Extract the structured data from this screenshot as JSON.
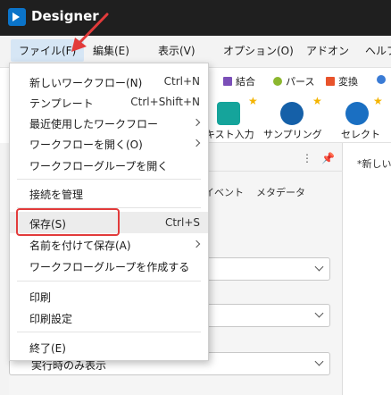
{
  "app": {
    "title": "Designer"
  },
  "menubar": {
    "items": [
      {
        "label": "ファイル(F)"
      },
      {
        "label": "編集(E)"
      },
      {
        "label": "表示(V)"
      },
      {
        "label": "オプション(O)"
      },
      {
        "label": "アドオン"
      },
      {
        "label": "ヘルプ"
      }
    ]
  },
  "toolbar": {
    "categories": [
      {
        "label": "結合",
        "color": "#7b4fb8"
      },
      {
        "label": "パース",
        "color": "#8cb72e"
      },
      {
        "label": "変換",
        "color": "#e8532b"
      }
    ],
    "tools": [
      {
        "label": "キスト入力",
        "color": "#15a49b"
      },
      {
        "label": "サンプリング",
        "color": "#1560a8"
      },
      {
        "label": "セレクト",
        "color": "#1a6fc2"
      }
    ]
  },
  "panel": {
    "tabs": [
      "イベント",
      "メタデータ"
    ],
    "select_value": "実行時のみ表示"
  },
  "canvas": {
    "tab_label": "*新しい"
  },
  "file_menu": {
    "items": [
      {
        "label": "新しいワークフロー(N)",
        "shortcut": "Ctrl+N"
      },
      {
        "label": "テンプレート",
        "shortcut": "Ctrl+Shift+N"
      },
      {
        "label": "最近使用したワークフロー",
        "submenu": true
      },
      {
        "label": "ワークフローを開く(O)",
        "submenu": true
      },
      {
        "label": "ワークフローグループを開く"
      },
      {
        "label": "接続を管理"
      },
      {
        "label": "保存(S)",
        "shortcut": "Ctrl+S"
      },
      {
        "label": "名前を付けて保存(A)",
        "submenu": true
      },
      {
        "label": "ワークフローグループを作成する"
      },
      {
        "label": "印刷"
      },
      {
        "label": "印刷設定"
      },
      {
        "label": "終了(E)"
      }
    ]
  },
  "colors": {
    "highlight": "#e23b3b",
    "accent": "#0b74c9"
  }
}
